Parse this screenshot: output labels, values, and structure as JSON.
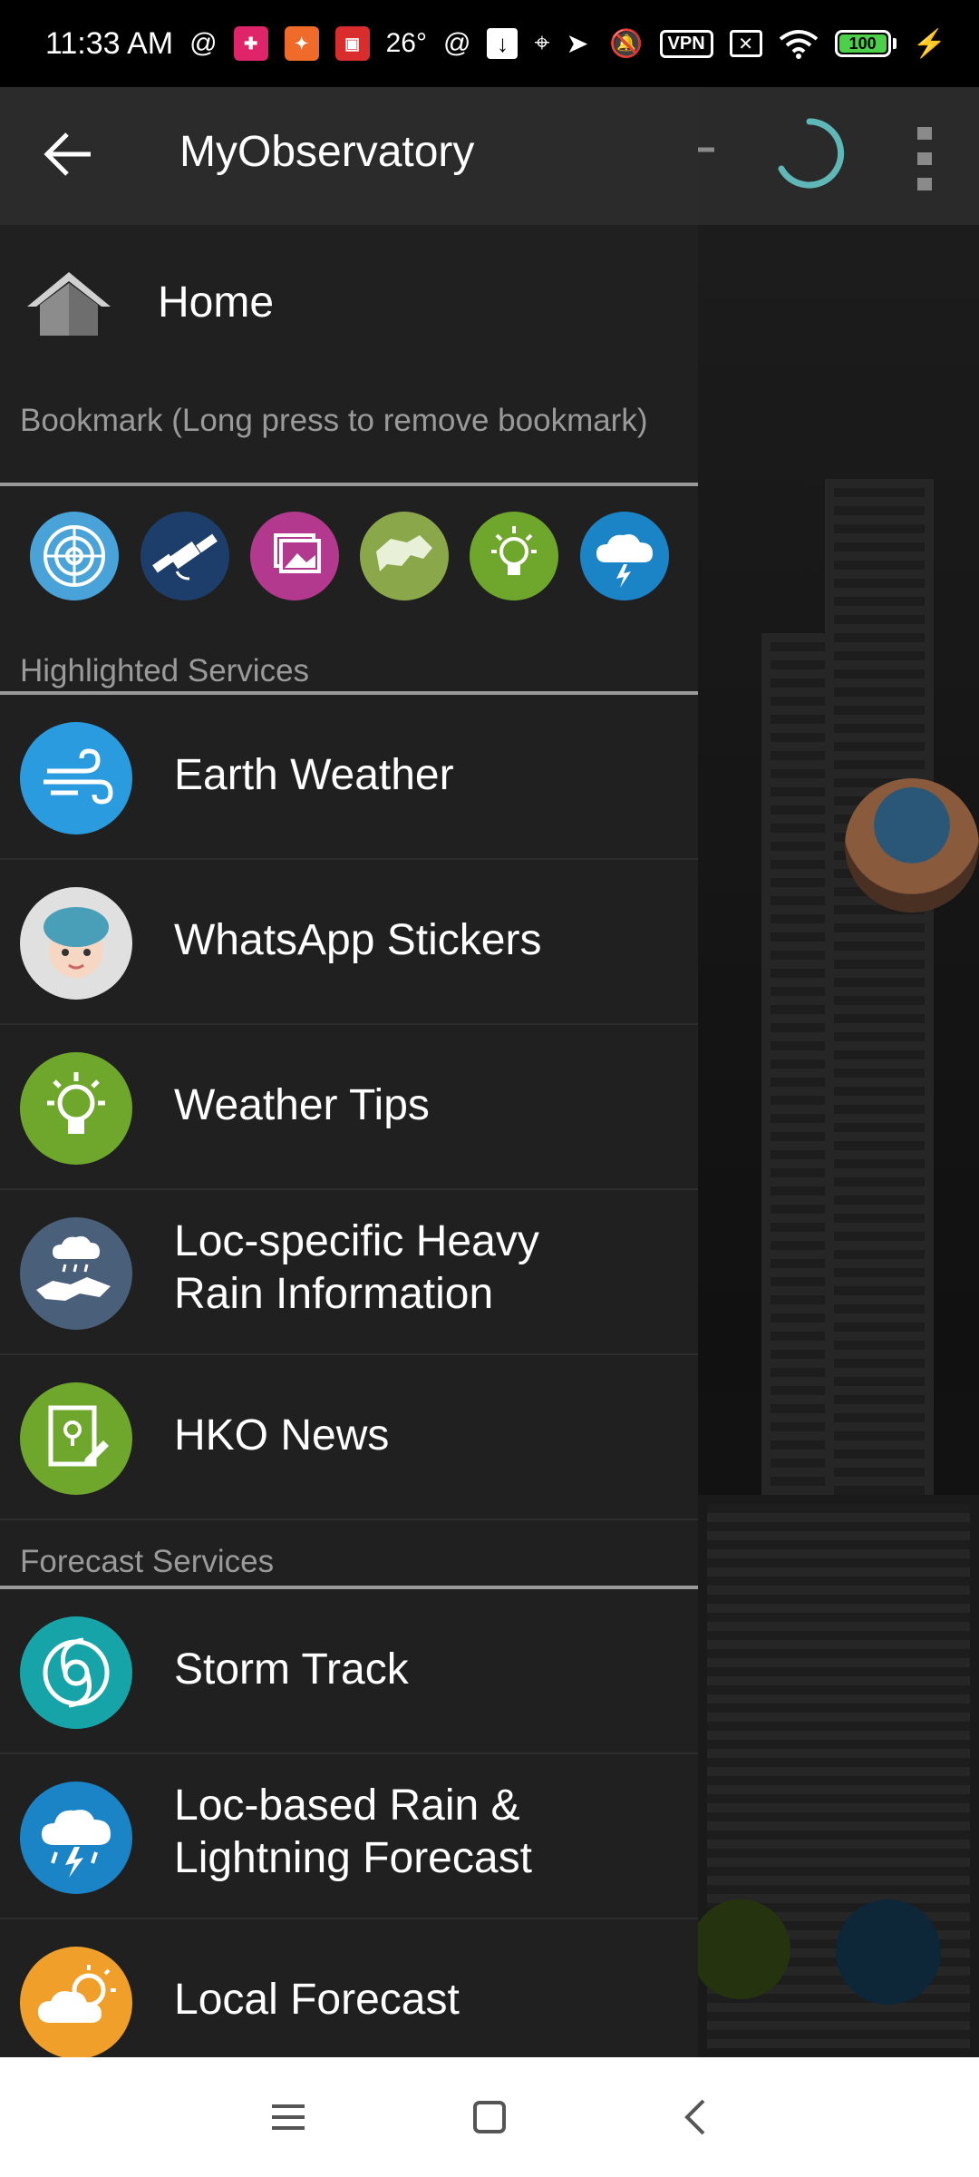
{
  "status_bar": {
    "time": "11:33 AM",
    "temperature": "26°",
    "vpn": "VPN",
    "battery": "100",
    "icons": [
      "at-sign-icon",
      "app-badge-icon",
      "app-badge-icon",
      "app-badge-icon",
      "at-sign-icon",
      "download-icon",
      "location-icon",
      "send-icon",
      "mute-icon",
      "vpn-icon",
      "close-box-icon",
      "wifi-icon",
      "battery-icon",
      "charging-icon"
    ]
  },
  "toolbar": {
    "title": "MyObservatory",
    "icons": [
      "back-arrow-icon",
      "add-icon",
      "loading-spinner-icon",
      "more-vert-icon"
    ]
  },
  "drawer": {
    "home": {
      "label": "Home",
      "icon": "home-icon"
    },
    "bookmark_header": "Bookmark (Long press to remove bookmark)",
    "bookmarks": [
      {
        "icon": "radar-icon",
        "color": "#4aa3d8"
      },
      {
        "icon": "satellite-icon",
        "color": "#1d3e6b"
      },
      {
        "icon": "image-gallery-icon",
        "color": "#b2398d"
      },
      {
        "icon": "hk-map-icon",
        "color": "#8aa84a"
      },
      {
        "icon": "lightbulb-icon",
        "color": "#6fa62c"
      },
      {
        "icon": "rain-lightning-icon",
        "color": "#1b84c6"
      }
    ],
    "highlighted_header": "Highlighted Services",
    "highlighted": [
      {
        "label": "Earth Weather",
        "icon": "wind-icon",
        "color": "#2b9be0"
      },
      {
        "label": "WhatsApp Stickers",
        "icon": "sticker-boy-icon",
        "color": "#e0e0e0"
      },
      {
        "label": "Weather Tips",
        "icon": "lightbulb-icon",
        "color": "#6fa62c"
      },
      {
        "label": "Loc-specific Heavy\nRain Information",
        "line1": "Loc-specific Heavy",
        "line2": "Rain Information",
        "icon": "heavy-rain-map-icon",
        "color": "#4a5f7a"
      },
      {
        "label": "HKO News",
        "icon": "news-icon",
        "color": "#6fa62c"
      }
    ],
    "forecast_header": "Forecast Services",
    "forecast": [
      {
        "label": "Storm Track",
        "icon": "storm-track-icon",
        "color": "#17a4a8"
      },
      {
        "line1": "Loc-based Rain &",
        "line2": "Lightning Forecast",
        "icon": "rain-lightning-icon",
        "color": "#1b84c6"
      },
      {
        "label": "Local Forecast",
        "icon": "sun-cloud-icon",
        "color": "#f0a02a"
      }
    ]
  },
  "nav_bar": {
    "icons": [
      "menu-icon",
      "home-square-icon",
      "back-icon"
    ]
  }
}
